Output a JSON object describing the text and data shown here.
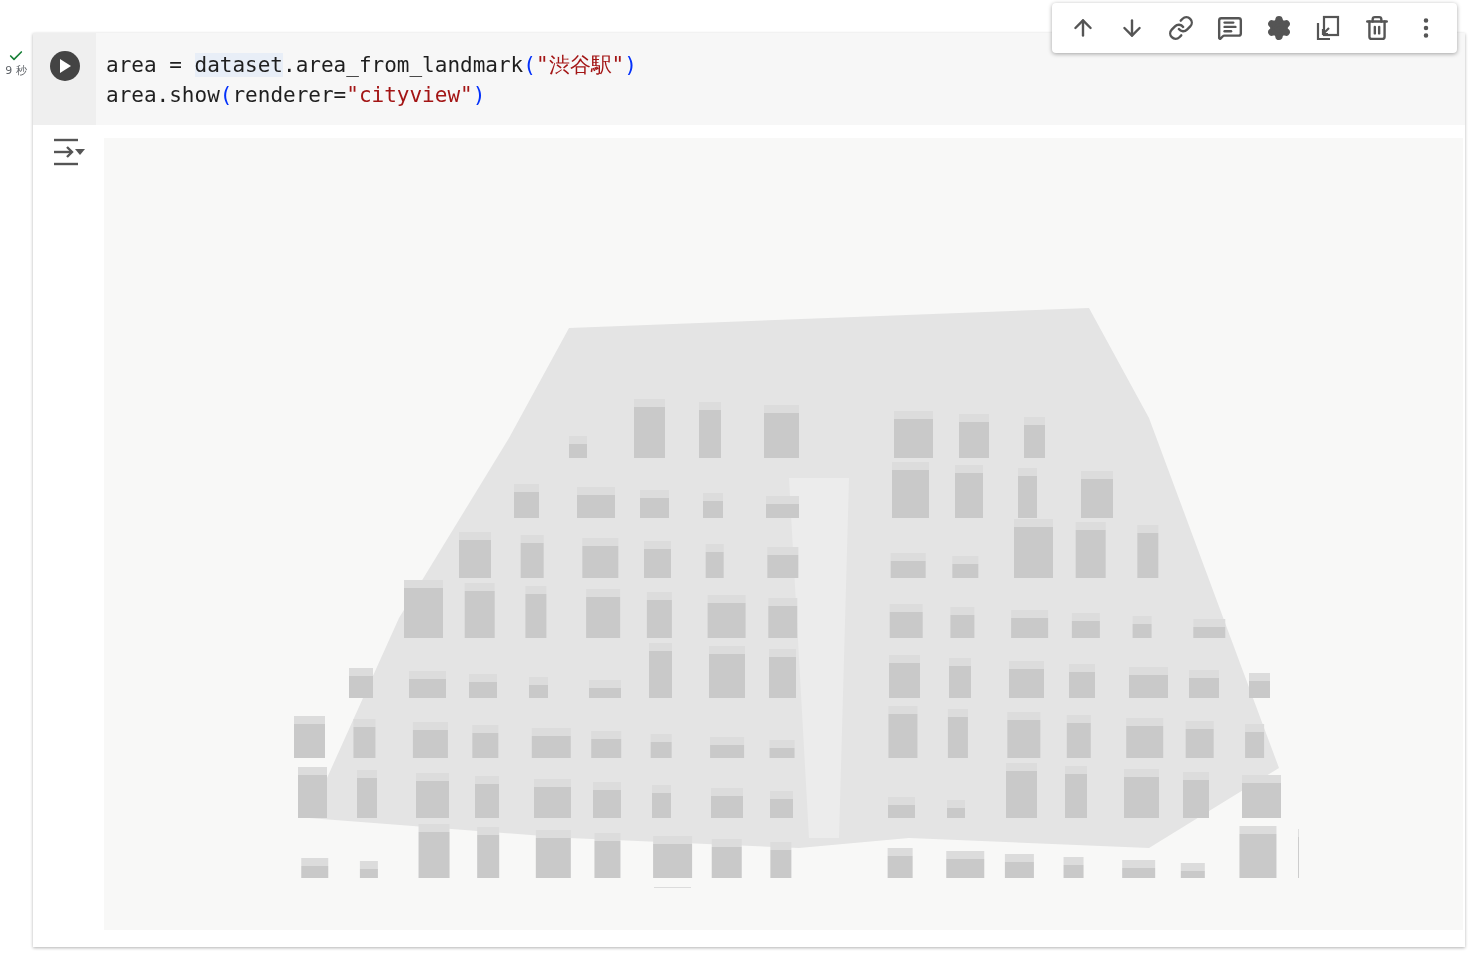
{
  "cell": {
    "status": {
      "done": true,
      "duration": "9 秒"
    },
    "code_lines": [
      [
        {
          "kind": "plain",
          "text": "area = "
        },
        {
          "kind": "highlight",
          "text": "dataset"
        },
        {
          "kind": "plain",
          "text": ".area_from_landmark"
        },
        {
          "kind": "bracket",
          "text": "("
        },
        {
          "kind": "string",
          "text": "\"渋谷駅\""
        },
        {
          "kind": "bracket",
          "text": ")"
        }
      ],
      [
        {
          "kind": "plain",
          "text": "area.show"
        },
        {
          "kind": "bracket",
          "text": "("
        },
        {
          "kind": "plain",
          "text": "renderer="
        },
        {
          "kind": "string",
          "text": "\"cityview\""
        },
        {
          "kind": "bracket",
          "text": ")"
        }
      ]
    ]
  }
}
